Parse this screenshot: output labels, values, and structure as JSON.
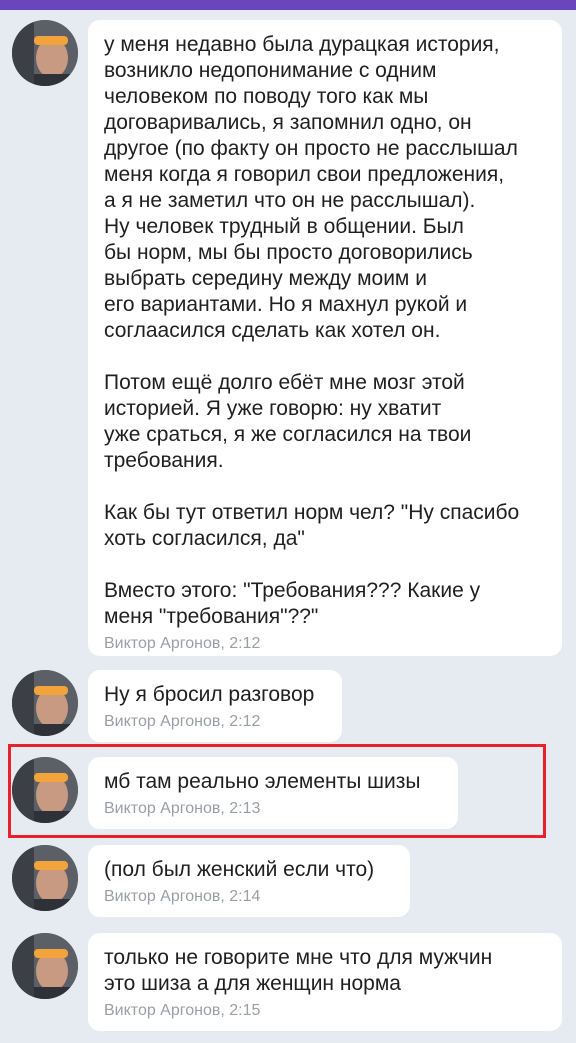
{
  "messages": [
    {
      "text": "у меня недавно была дурацкая история,\nвозникло недопонимание с одним\nчеловеком по поводу того как мы\nдоговаривались, я запомнил одно, он\nдругое (по факту он просто не расслышал\nменя когда я говорил свои предложения,\nа я не заметил что он не расслышал).\nНу человек трудный в общении. Был\nбы норм, мы бы просто договорились\nвыбрать середину между моим и\nего вариантами. Но я махнул рукой и\nсоглаасился сделать как хотел он.\n\nПотом ещё долго ебёт мне мозг этой\nисторией. Я уже говорю: ну хватит\nуже сраться, я же согласился на твои\nтребования.\n\nКак бы тут ответил норм чел? \"Ну спасибо\nхоть согласился, да\"\n\nВместо этого: \"Требования??? Какие у\nменя \"требования\"??\"",
      "author": "Виктор Аргонов",
      "time": "2:12",
      "meta": "Виктор Аргонов, 2:12"
    },
    {
      "text": "Ну я бросил разговор",
      "author": "Виктор Аргонов",
      "time": "2:12",
      "meta": "Виктор Аргонов, 2:12"
    },
    {
      "text": "мб там реально элементы шизы",
      "author": "Виктор Аргонов",
      "time": "2:13",
      "meta": "Виктор Аргонов, 2:13",
      "highlighted": true
    },
    {
      "text": "(пол был женский если что)",
      "author": "Виктор Аргонов",
      "time": "2:14",
      "meta": "Виктор Аргонов, 2:14"
    },
    {
      "text": "только не говорите мне что для мужчин\nэто шиза а для женщин норма",
      "author": "Виктор Аргонов",
      "time": "2:15",
      "meta": "Виктор Аргонов, 2:15"
    }
  ],
  "colors": {
    "accent": "#6a45bb",
    "background": "#e6ebf2",
    "bubble": "#ffffff",
    "highlight": "#e8212a",
    "meta": "#9a9ea5"
  }
}
